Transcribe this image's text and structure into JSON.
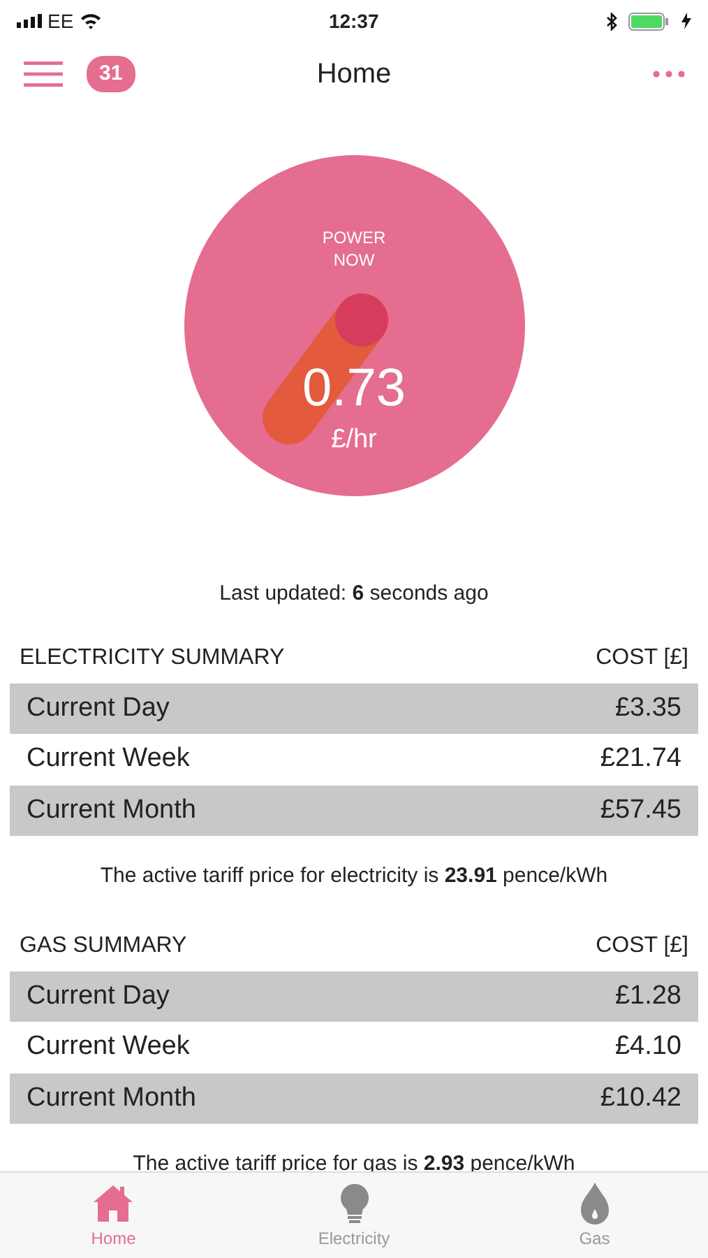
{
  "status_bar": {
    "carrier": "EE",
    "time": "12:37"
  },
  "nav": {
    "badge": "31",
    "title": "Home"
  },
  "gauge": {
    "label": "POWER NOW",
    "value": "0.73",
    "unit": "£/hr"
  },
  "last_updated": "Last updated: **6** seconds ago",
  "sections": [
    {
      "title": "ELECTRICITY SUMMARY",
      "cost_header": "COST [£]",
      "rows": [
        {
          "period": "Current Day",
          "cost": "£3.35"
        },
        {
          "period": "Current Week",
          "cost": "£21.74"
        },
        {
          "period": "Current Month",
          "cost": "£57.45"
        }
      ],
      "tariff": "The active tariff price for electricity is **23.91** pence/kWh"
    },
    {
      "title": "GAS SUMMARY",
      "cost_header": "COST [£]",
      "rows": [
        {
          "period": "Current Day",
          "cost": "£1.28"
        },
        {
          "period": "Current Week",
          "cost": "£4.10"
        },
        {
          "period": "Current Month",
          "cost": "£10.42"
        }
      ],
      "tariff": "The active tariff price for gas is **2.93** pence/kWh"
    }
  ],
  "tabs": [
    {
      "label": "Home",
      "kind": "home",
      "selected": true
    },
    {
      "label": "Electricity",
      "kind": "bulb",
      "selected": false
    },
    {
      "label": "Gas",
      "kind": "flame",
      "selected": false
    }
  ]
}
